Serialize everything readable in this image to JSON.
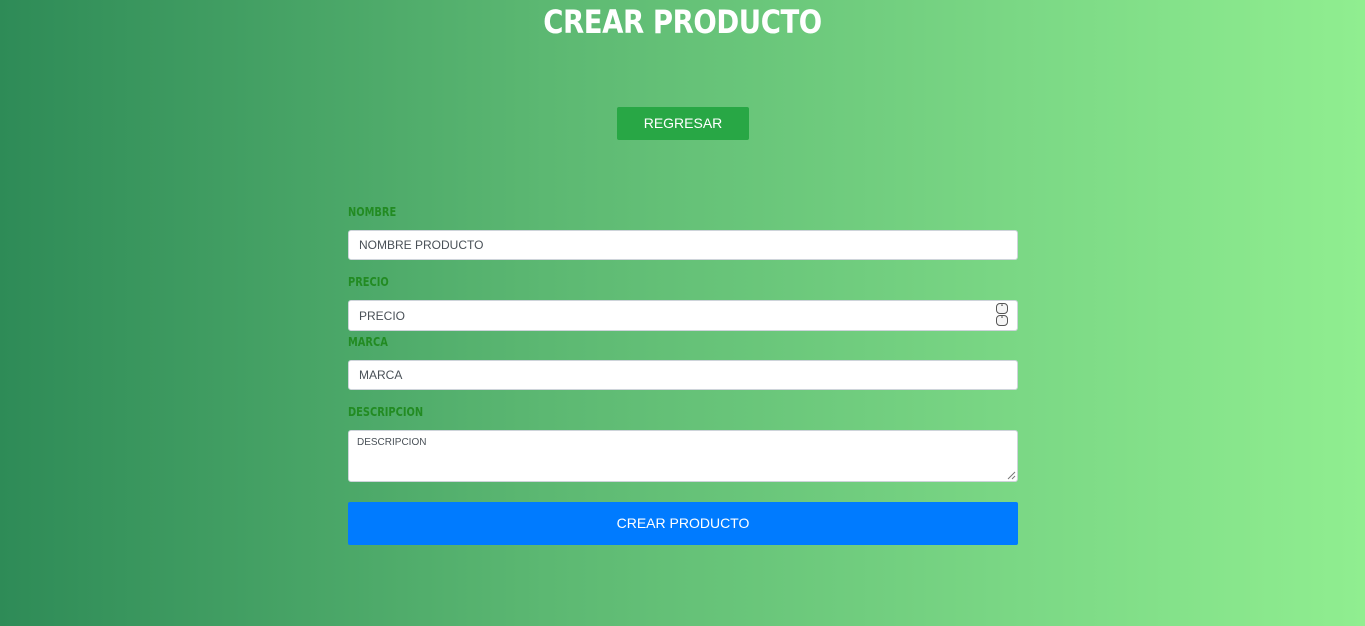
{
  "page": {
    "title": "CREAR PRODUCTO"
  },
  "actions": {
    "back_label": "REGRESAR",
    "submit_label": "CREAR PRODUCTO"
  },
  "form": {
    "nombre": {
      "label": "NOMBRE",
      "placeholder": "NOMBRE PRODUCTO",
      "value": ""
    },
    "precio": {
      "label": "PRECIO",
      "placeholder": "PRECIO",
      "value": ""
    },
    "marca": {
      "label": "MARCA",
      "placeholder": "MARCA",
      "value": ""
    },
    "descripcion": {
      "label": "DESCRIPCION",
      "placeholder": "DESCRIPCION",
      "value": ""
    }
  },
  "icons": {
    "spinner_up": "chevron-up-icon",
    "spinner_down": "chevron-down-icon",
    "resize": "resize-grip-icon"
  },
  "colors": {
    "gradient_start": "#2e8b57",
    "gradient_end": "#90ee90",
    "back_button": "#28a745",
    "submit_button": "#007bff",
    "label_text": "#228b22"
  }
}
